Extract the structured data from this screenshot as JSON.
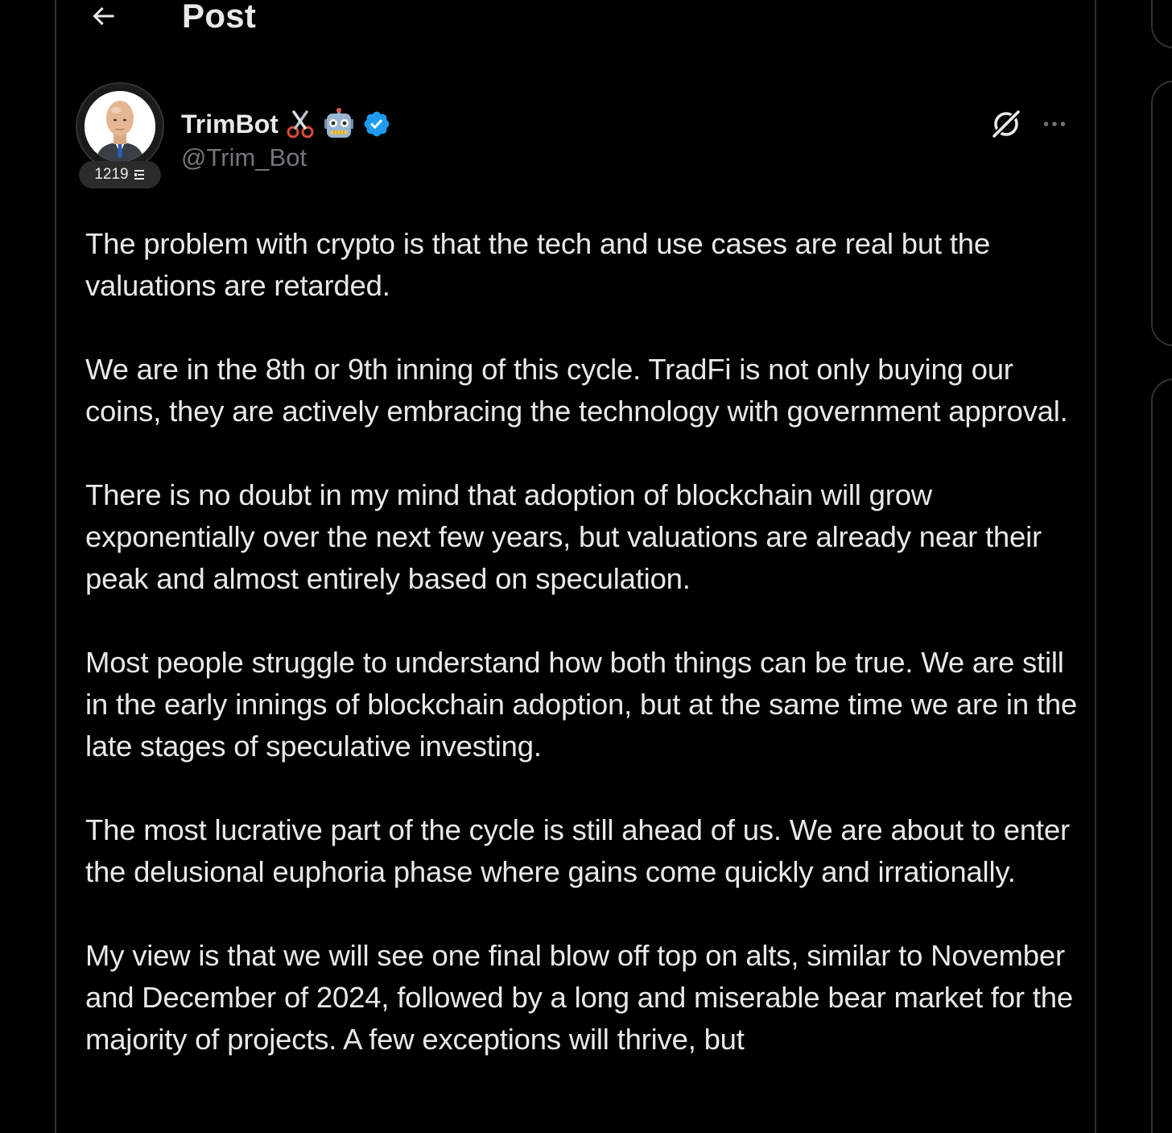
{
  "header": {
    "back_icon": "arrow-left-icon",
    "title": "Post"
  },
  "author": {
    "display_name": "TrimBot",
    "name_emojis": [
      "scissors-icon",
      "robot-face-icon"
    ],
    "verified_icon": "verified-badge-icon",
    "handle": "@Trim_Bot",
    "badge_count": "1219"
  },
  "actions": {
    "grok_icon": "grok-icon",
    "more_icon": "more-horizontal-icon"
  },
  "post": {
    "paragraphs": [
      "The problem with crypto is that the tech and use cases are real but the valuations are retarded.",
      "We are in the 8th or 9th inning of this cycle. TradFi is not only buying our coins, they are actively embracing the technology with government approval.",
      "There is no doubt in my mind that adoption of blockchain will grow exponentially over the next few years, but valuations are already near their peak and almost entirely based on speculation.",
      "Most people struggle to understand how both things can be true. We are still in the early innings of blockchain adoption, but at the same time we are in the late stages of speculative investing.",
      "The most lucrative part of the cycle is still ahead of us. We are about to enter the delusional euphoria phase where gains come quickly and irrationally.",
      "My view is that we will see one final blow off top on alts, similar to November and December of 2024, followed by a long and miserable bear market for the majority of projects. A few exceptions will thrive, but"
    ]
  },
  "colors": {
    "background": "#000000",
    "text_primary": "#e7e9ea",
    "text_secondary": "#71767b",
    "border": "#2f3336",
    "verified_blue": "#1d9bf0"
  }
}
